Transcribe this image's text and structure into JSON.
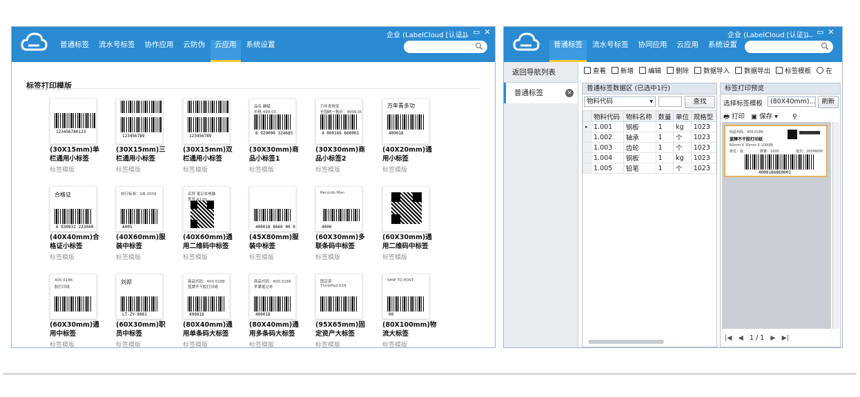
{
  "left": {
    "nav": [
      "普通标签",
      "流水号标签",
      "协作应用",
      "云防伪",
      "云应用",
      "系统设置"
    ],
    "active_nav": "云应用",
    "company": "企业 (LabelCloud [认证])",
    "window_controls": [
      "﹏",
      "▭",
      "✕"
    ],
    "section_title": "标签打印模版",
    "tiles": [
      {
        "name": "(30X15mm)单栏通用小标签",
        "sub": "标签模版",
        "code": "123456780123"
      },
      {
        "name": "(30X15mm)三栏通用小标签",
        "sub": "标签模版",
        "code": "123456789"
      },
      {
        "name": "(30X15mm)双栏通用小标签",
        "sub": "标签模版",
        "code": "123456789"
      },
      {
        "name": "(30X30mm)商品小标签1",
        "sub": "标签模版",
        "code": "6 929000 324685",
        "t1": "品名    蜗蜡",
        "t2": "价格    499.00"
      },
      {
        "name": "(30X30mm)商品小标签2",
        "sub": "标签模版",
        "code": "4 000186 660001",
        "t1": "万年青珠宝",
        "t2": "全国统一售价：4999.00"
      },
      {
        "name": "(40X20mm)通用小标签",
        "sub": "标签模版",
        "code": "400018",
        "t1": "万年青多功"
      },
      {
        "name": "(40X40mm)合格证小标签",
        "sub": "标签模版",
        "code": "6 930932 223040",
        "t1": "合格证"
      },
      {
        "name": "(40X60mm)服装中标签",
        "sub": "标签模版",
        "code": "A005",
        "t1": "执行标准：GB-2009"
      },
      {
        "name": "(40X60mm)通用二维码中标签",
        "sub": "标签模版",
        "t1": "名称  笔记本电脑",
        "t2": "型号  R120"
      },
      {
        "name": "(45X80mm)服装中标签",
        "sub": "标签模版",
        "code": "400018 8660 00 0"
      },
      {
        "name": "(60X30mm)多联条码中标签",
        "sub": "标签模版",
        "code": "4000",
        "t1": "Records Man"
      },
      {
        "name": "(60X30mm)通用二维码中标签",
        "sub": "标签模版"
      },
      {
        "name": "(60X30mm)通用中标签",
        "sub": "标签模版",
        "t1": "400.0186",
        "t2": "胶打印纸"
      },
      {
        "name": "(60X30mm)职员中标签",
        "sub": "标签模版",
        "t1": "刘邦",
        "code": "LT-ZY-0001"
      },
      {
        "name": "(80X40mm)通用单条码大标签",
        "sub": "标签模版",
        "t1": "商品代码：400.0186",
        "t2": "蓝牌不干胶打印纸",
        "code": "400018"
      },
      {
        "name": "(80X40mm)通用多条码大标签",
        "sub": "标签模版",
        "t1": "商品代码：400.0186",
        "t2": "苹果笔记本",
        "code": "400018"
      },
      {
        "name": "(95X65mm)固定资产大标签",
        "sub": "标签模版",
        "t1": "固定资",
        "t2": "ThinkPad X24"
      },
      {
        "name": "(80X100mm)物流大标签",
        "sub": "标签模版",
        "t1": "SHIP TO POST",
        "code": "00"
      }
    ]
  },
  "right": {
    "nav": [
      "普通标签",
      "流水号标签",
      "协同应用",
      "云应用",
      "系统设置"
    ],
    "active_nav": "普通标签",
    "company": "企业 (LabelCloud [认证])",
    "window_controls": [
      "﹏",
      "▭",
      "✕"
    ],
    "side": {
      "back": "返回导航列表",
      "current": "普通标签",
      "close": "✕"
    },
    "toolbar": [
      "查看",
      "新增",
      "编辑",
      "删除",
      "数据导入",
      "数据导出",
      "标签模板",
      "在"
    ],
    "data_panel": {
      "title": "普通标签数据区 (已选中1行)",
      "filter_field": "物料代码",
      "filter_value": "",
      "search_btn": "查找",
      "columns": [
        "物料代码",
        "物料名称",
        "数量",
        "单位",
        "规格型"
      ],
      "rows": [
        [
          "1.001",
          "钢板",
          "1",
          "kg",
          "1023"
        ],
        [
          "1.002",
          "轴承",
          "1",
          "个",
          "1023"
        ],
        [
          "1.003",
          "齿轮",
          "1",
          "个",
          "1023"
        ],
        [
          "1.004",
          "钢板",
          "1",
          "kg",
          "1023"
        ],
        [
          "1.005",
          "铅笔",
          "1",
          "个",
          "1023"
        ]
      ]
    },
    "preview": {
      "title": "标签打印预览",
      "template_label": "选择标签模板",
      "template_value": "(80X40mm)...",
      "refresh": "刷新",
      "print": "打印",
      "save": "保存",
      "label_code": "商品代码：400.0186",
      "label_name": "蓝牌不干胶打印纸",
      "label_spec": "60mm X 30mm X 1000张",
      "label_unit": "单位：张",
      "label_qty": "数量：1000",
      "label_batch": "批次：2009W08",
      "label_barcode": "4000186860001",
      "page": "1 / 1"
    }
  }
}
